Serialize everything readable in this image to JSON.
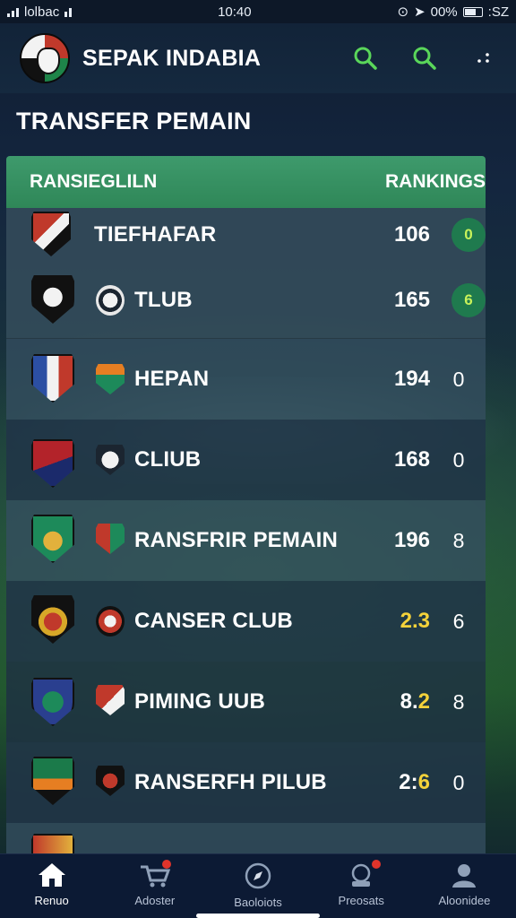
{
  "status_bar": {
    "carrier": "lolbac",
    "time": "10:40",
    "battery": "00%",
    "extra": ":SZ"
  },
  "app": {
    "title": "SEPAK INDABIA"
  },
  "section": {
    "title": "TRANSFER PEMAIN"
  },
  "table": {
    "header_left": "RANSIEGLILN",
    "header_right": "RANKINGS",
    "rows": [
      {
        "name": "TIEFHAFAR",
        "score": "106",
        "rank": "0",
        "rank_style": "pill",
        "crest_colors": [
          "#c0392b",
          "#111111"
        ]
      },
      {
        "name": "TLUB",
        "score": "165",
        "rank": "6",
        "rank_style": "pill",
        "crest_colors": [
          "#111111",
          "#f2f2f2"
        ]
      },
      {
        "name": "HEPAN",
        "score": "194",
        "rank": "0",
        "rank_style": "text",
        "crest_colors": [
          "#2c4fa3",
          "#c0392b"
        ]
      },
      {
        "name": "CLIUB",
        "score": "168",
        "rank": "0",
        "rank_style": "text",
        "crest_colors": [
          "#b3232a",
          "#1b2a6b"
        ]
      },
      {
        "name": "RANSFRIR PEMAIN",
        "score": "196",
        "rank": "8",
        "rank_style": "text",
        "crest_colors": [
          "#1d8a5a",
          "#e2b13c"
        ]
      },
      {
        "name": "CANSER CLUB",
        "score_plain": "",
        "score_highlight": "2.3",
        "rank": "6",
        "rank_style": "text",
        "crest_colors": [
          "#111111",
          "#d7a728"
        ]
      },
      {
        "name": "PIMING UUB",
        "score_plain": "8.",
        "score_highlight": "2",
        "rank": "8",
        "rank_style": "text",
        "crest_colors": [
          "#2a3f8f",
          "#1d8a5a"
        ]
      },
      {
        "name": "RANSERFH PILUB",
        "score_plain": "2:",
        "score_highlight": "6",
        "rank": "0",
        "rank_style": "text",
        "crest_colors": [
          "#1b7a4a",
          "#e67e22"
        ]
      }
    ]
  },
  "nav": {
    "items": [
      {
        "label": "Renuo",
        "icon": "home-icon",
        "active": true
      },
      {
        "label": "Adoster",
        "icon": "cart-icon",
        "active": false
      },
      {
        "label": "Baoloiots",
        "icon": "compass-icon",
        "active": false
      },
      {
        "label": "Preosats",
        "icon": "transfer-icon",
        "active": false
      },
      {
        "label": "Aloonidee",
        "icon": "profile-icon",
        "active": false
      }
    ]
  },
  "colors": {
    "accent_green": "#3e9a6c",
    "highlight_yellow": "#f4d23a",
    "header_bg": "#122338"
  }
}
